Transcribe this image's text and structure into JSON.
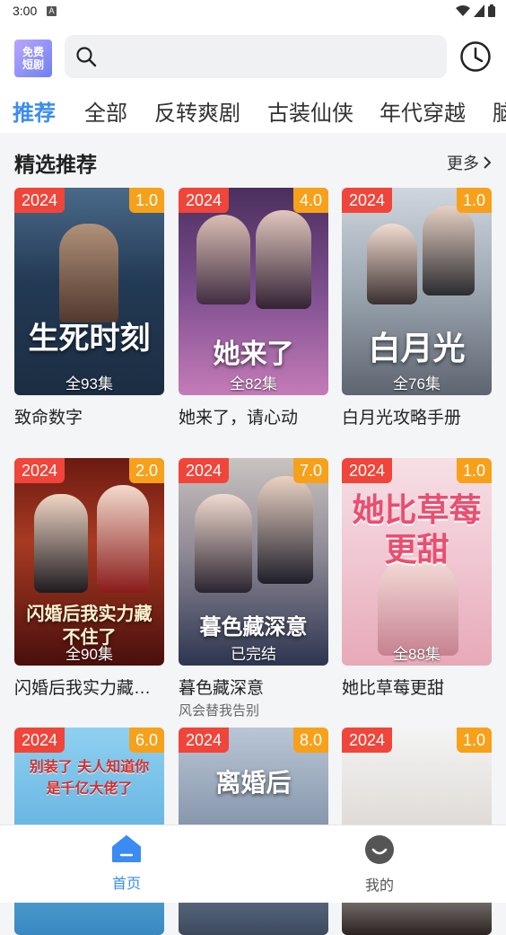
{
  "status_bar": {
    "time": "3:00",
    "badge": "A"
  },
  "header": {
    "logo_line1": "免费",
    "logo_line2": "短剧",
    "search_placeholder": ""
  },
  "tabs": [
    "推荐",
    "全部",
    "反转爽剧",
    "古装仙侠",
    "年代穿越",
    "脑"
  ],
  "section": {
    "title": "精选推荐",
    "more": "更多"
  },
  "cards": [
    {
      "year": "2024",
      "rating": "1.0",
      "episodes": "全93集",
      "title": "致命数字",
      "poster_text": "生死时刻"
    },
    {
      "year": "2024",
      "rating": "4.0",
      "episodes": "全82集",
      "title": "她来了，请心动",
      "poster_text": "她来了"
    },
    {
      "year": "2024",
      "rating": "1.0",
      "episodes": "全76集",
      "title": "白月光攻略手册",
      "poster_text": "白月光"
    },
    {
      "year": "2024",
      "rating": "2.0",
      "episodes": "全90集",
      "title": "闪婚后我实力藏…",
      "poster_text": "闪婚后我实力藏不住了"
    },
    {
      "year": "2024",
      "rating": "7.0",
      "episodes": "已完结",
      "title": "暮色藏深意",
      "subtitle": "风会替我告别",
      "poster_text": "暮色藏深意"
    },
    {
      "year": "2024",
      "rating": "1.0",
      "episodes": "全88集",
      "title": "她比草莓更甜",
      "poster_text": "她比草莓更甜"
    },
    {
      "year": "2024",
      "rating": "6.0",
      "poster_text": "别装了 夫人知道你是千亿大佬了"
    },
    {
      "year": "2024",
      "rating": "8.0",
      "poster_text": "离婚后"
    },
    {
      "year": "2024",
      "rating": "1.0",
      "poster_text": ""
    }
  ],
  "bottom_nav": {
    "home": "首页",
    "me": "我的"
  },
  "colors": {
    "accent": "#3a8cf3",
    "year_badge": "#f0453a",
    "rating_badge": "#f7a11b"
  }
}
